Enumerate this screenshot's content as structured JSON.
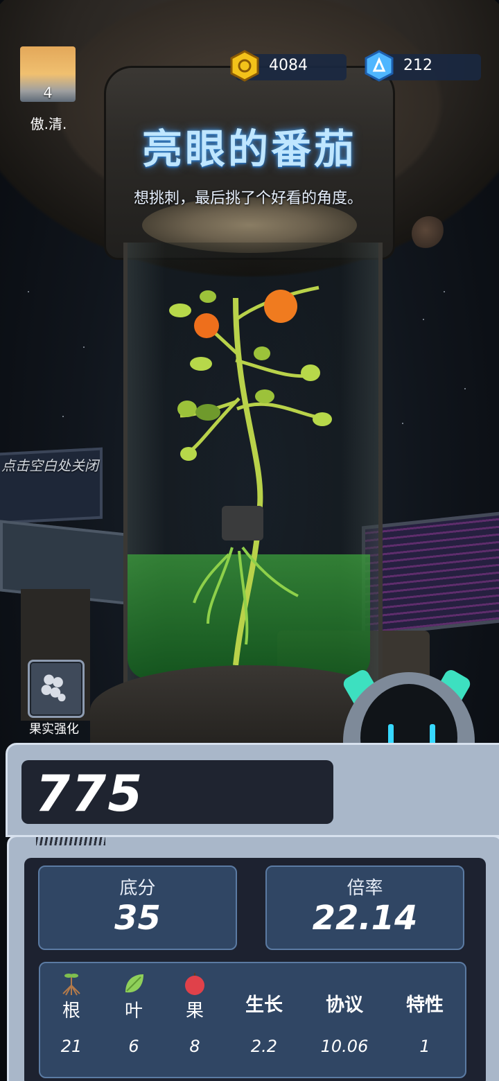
{
  "player": {
    "level": "4",
    "name": "傲.清."
  },
  "currency": {
    "gold": {
      "icon": "gold-coin-icon",
      "value": "4084",
      "color": "#f3c21a"
    },
    "gem": {
      "icon": "blue-gem-icon",
      "value": "212",
      "color": "#4fb6ff"
    }
  },
  "plant": {
    "title": "亮眼的番茄",
    "description": "想挑刺，最后挑了个好看的角度。"
  },
  "hint": {
    "close": "点击空白处关闭"
  },
  "fruit_boost": {
    "label": "果实强化",
    "icon": "berry-cluster-icon"
  },
  "score": {
    "total": "775"
  },
  "stats": {
    "base": {
      "label": "底分",
      "value": "35"
    },
    "multiplier": {
      "label": "倍率",
      "value": "22.14"
    }
  },
  "table": {
    "columns": [
      {
        "label": "根",
        "icon": "root-icon",
        "value": "21"
      },
      {
        "label": "叶",
        "icon": "leaf-icon",
        "value": "6"
      },
      {
        "label": "果",
        "icon": "tomato-icon",
        "value": "8"
      },
      {
        "label": "生长",
        "value": "2.2"
      },
      {
        "label": "协议",
        "value": "10.06"
      },
      {
        "label": "特性",
        "value": "1"
      }
    ]
  },
  "colors": {
    "title_glow": "#3d8fd6",
    "panel": "#a9b7c9",
    "stat_box": "#304664",
    "liquid": "#2e8a36"
  }
}
